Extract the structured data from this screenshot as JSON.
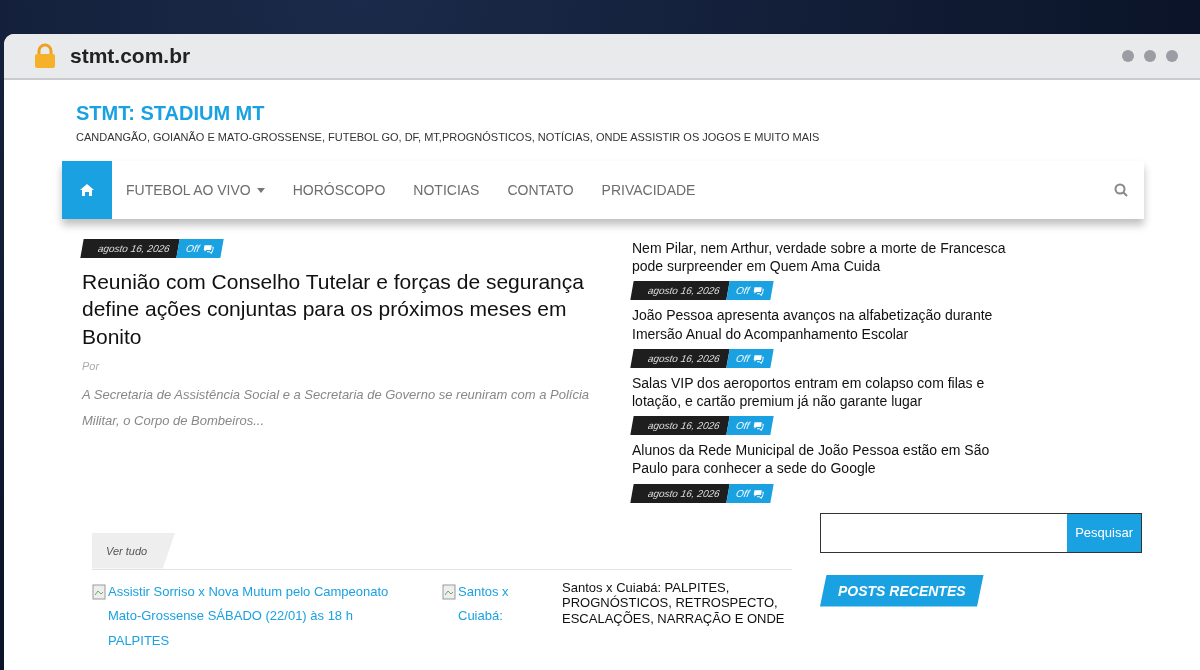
{
  "browser": {
    "url": "stmt.com.br"
  },
  "site": {
    "title": "STMT: STADIUM MT",
    "tagline": "CANDANGÃO, GOIANÃO E MATO-GROSSENSE, FUTEBOL GO, DF, MT,PROGNÓSTICOS, NOTÍCIAS, ONDE ASSISTIR OS JOGOS E MUITO MAIS"
  },
  "nav": {
    "items": [
      {
        "label": "FUTEBOL AO VIVO",
        "dropdown": true
      },
      {
        "label": "HORÓSCOPO",
        "dropdown": false
      },
      {
        "label": "NOTICIAS",
        "dropdown": false
      },
      {
        "label": "CONTATO",
        "dropdown": false
      },
      {
        "label": "PRIVACIDADE",
        "dropdown": false
      }
    ]
  },
  "featured": {
    "date": "agosto 16, 2026",
    "comments": "Off",
    "title": "Reunião com Conselho Tutelar e forças de segurança define ações conjuntas para os próximos meses em Bonito",
    "byline": "Por",
    "excerpt": "A Secretaria de Assistência Social e a Secretaria de Governo se reuniram com a Polícia Militar, o Corpo de Bombeiros..."
  },
  "side_posts": [
    {
      "title": "Nem Pilar, nem Arthur, verdade sobre a morte de Francesca pode surpreender em Quem Ama Cuida",
      "date": "agosto 16, 2026",
      "comments": "Off"
    },
    {
      "title": "João Pessoa apresenta avanços na alfabetização durante Imersão Anual do Acompanhamento Escolar",
      "date": "agosto 16, 2026",
      "comments": "Off"
    },
    {
      "title": "Salas VIP dos aeroportos entram em colapso com filas e lotação, e cartão premium já não garante lugar",
      "date": "agosto 16, 2026",
      "comments": "Off"
    },
    {
      "title": "Alunos da Rede Municipal de João Pessoa estão em São Paulo para conhecer a sede do Google",
      "date": "agosto 16, 2026",
      "comments": "Off"
    }
  ],
  "section": {
    "tab": "Ver tudo",
    "items": [
      {
        "alt": "Assistir Sorriso x Nova Mutum pelo Campeonato Mato-Grossense SÁBADO (22/01) às 18 h PALPITES"
      },
      {
        "alt": "Santos x Cuiabá:",
        "title": "Santos x Cuiabá: PALPITES, PROGNÓSTICOS, RETROSPECTO, ESCALAÇÕES, NARRAÇÃO E ONDE"
      }
    ]
  },
  "sidebar": {
    "search_button": "Pesquisar",
    "widget_title": "POSTS RECENTES"
  }
}
